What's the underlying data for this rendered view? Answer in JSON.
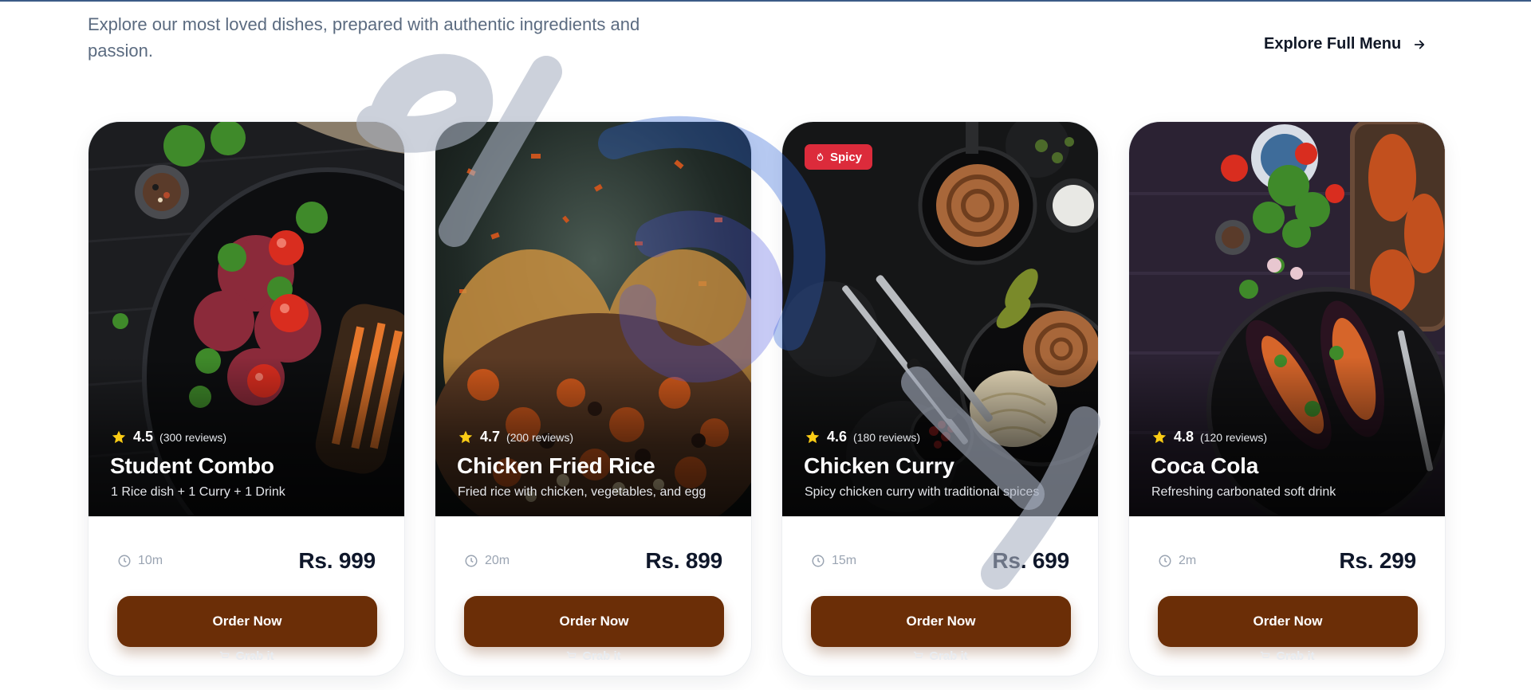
{
  "intro": {
    "subtitle": "Explore our most loved dishes, prepared with authentic ingredients and passion."
  },
  "explore_link": {
    "label": "Explore Full Menu",
    "icon": "arrow-right-icon"
  },
  "colors": {
    "button": "#6b2e07",
    "badge": "#dc2b3b",
    "star": "#facc15",
    "price": "#0f172a"
  },
  "cards": [
    {
      "rating": "4.5",
      "reviews": "(300 reviews)",
      "title": "Student Combo",
      "description": "1 Rice dish + 1 Curry + 1 Drink",
      "time": "10m",
      "price": "Rs. 999",
      "button": "Order Now",
      "secondary": "Grab it",
      "badge": ""
    },
    {
      "rating": "4.7",
      "reviews": "(200 reviews)",
      "title": "Chicken Fried Rice",
      "description": "Fried rice with chicken, vegetables, and egg",
      "time": "20m",
      "price": "Rs. 899",
      "button": "Order Now",
      "secondary": "Grab it",
      "badge": ""
    },
    {
      "rating": "4.6",
      "reviews": "(180 reviews)",
      "title": "Chicken Curry",
      "description": "Spicy chicken curry with traditional spices",
      "time": "15m",
      "price": "Rs. 699",
      "button": "Order Now",
      "secondary": "Grab it",
      "badge": "Spicy"
    },
    {
      "rating": "4.8",
      "reviews": "(120 reviews)",
      "title": "Coca Cola",
      "description": "Refreshing carbonated soft drink",
      "time": "2m",
      "price": "Rs. 299",
      "button": "Order Now",
      "secondary": "Grab it",
      "badge": ""
    }
  ]
}
